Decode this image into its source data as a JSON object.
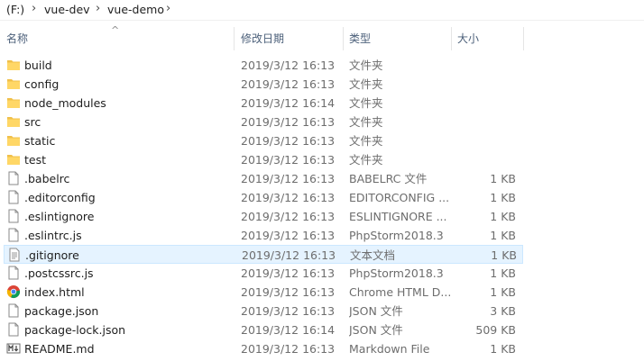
{
  "breadcrumb": {
    "items": [
      "(F:)",
      "vue-dev",
      "vue-demo"
    ],
    "separator": "›"
  },
  "columns": {
    "name": "名称",
    "date": "修改日期",
    "type": "类型",
    "size": "大小",
    "sort_indicator": "^"
  },
  "colors": {
    "folder": "#f0c04a",
    "selected_bg": "#e5f3ff",
    "header_text": "#4c607a"
  },
  "files": [
    {
      "name": "build",
      "date": "2019/3/12 16:13",
      "type": "文件夹",
      "size": "",
      "icon": "folder-icon"
    },
    {
      "name": "config",
      "date": "2019/3/12 16:13",
      "type": "文件夹",
      "size": "",
      "icon": "folder-icon"
    },
    {
      "name": "node_modules",
      "date": "2019/3/12 16:14",
      "type": "文件夹",
      "size": "",
      "icon": "folder-icon"
    },
    {
      "name": "src",
      "date": "2019/3/12 16:13",
      "type": "文件夹",
      "size": "",
      "icon": "folder-icon"
    },
    {
      "name": "static",
      "date": "2019/3/12 16:13",
      "type": "文件夹",
      "size": "",
      "icon": "folder-icon"
    },
    {
      "name": "test",
      "date": "2019/3/12 16:13",
      "type": "文件夹",
      "size": "",
      "icon": "folder-icon"
    },
    {
      "name": ".babelrc",
      "date": "2019/3/12 16:13",
      "type": "BABELRC 文件",
      "size": "1 KB",
      "icon": "file-icon"
    },
    {
      "name": ".editorconfig",
      "date": "2019/3/12 16:13",
      "type": "EDITORCONFIG ...",
      "size": "1 KB",
      "icon": "file-icon"
    },
    {
      "name": ".eslintignore",
      "date": "2019/3/12 16:13",
      "type": "ESLINTIGNORE ...",
      "size": "1 KB",
      "icon": "file-icon"
    },
    {
      "name": ".eslintrc.js",
      "date": "2019/3/12 16:13",
      "type": "PhpStorm2018.3",
      "size": "1 KB",
      "icon": "file-icon"
    },
    {
      "name": ".gitignore",
      "date": "2019/3/12 16:13",
      "type": "文本文档",
      "size": "1 KB",
      "icon": "text-file-icon",
      "selected": true
    },
    {
      "name": ".postcssrc.js",
      "date": "2019/3/12 16:13",
      "type": "PhpStorm2018.3",
      "size": "1 KB",
      "icon": "file-icon"
    },
    {
      "name": "index.html",
      "date": "2019/3/12 16:13",
      "type": "Chrome HTML D...",
      "size": "1 KB",
      "icon": "chrome-icon"
    },
    {
      "name": "package.json",
      "date": "2019/3/12 16:13",
      "type": "JSON 文件",
      "size": "3 KB",
      "icon": "file-icon"
    },
    {
      "name": "package-lock.json",
      "date": "2019/3/12 16:14",
      "type": "JSON 文件",
      "size": "509 KB",
      "icon": "file-icon"
    },
    {
      "name": "README.md",
      "date": "2019/3/12 16:13",
      "type": "Markdown File",
      "size": "1 KB",
      "icon": "markdown-file-icon"
    }
  ]
}
